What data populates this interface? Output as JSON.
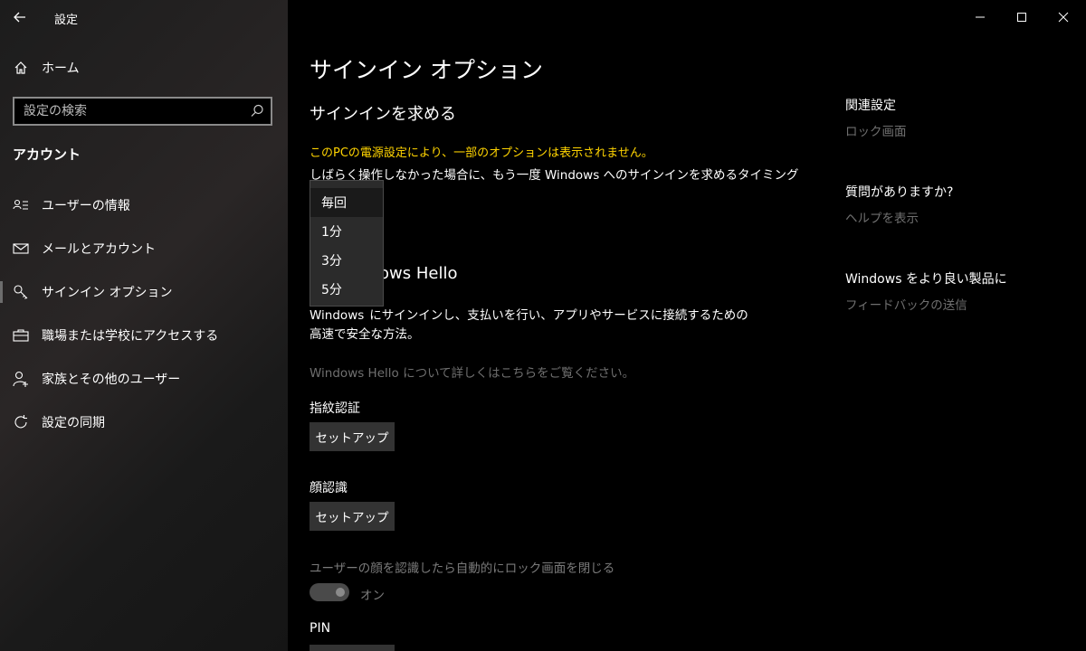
{
  "window": {
    "title": "設定",
    "controls": [
      "minimize",
      "maximize",
      "close"
    ]
  },
  "sidebar": {
    "home_label": "ホーム",
    "search_placeholder": "設定の検索",
    "section_label": "アカウント",
    "items": [
      {
        "label": "ユーザーの情報",
        "icon": "user-info-icon"
      },
      {
        "label": "メールとアカウント",
        "icon": "mail-icon"
      },
      {
        "label": "サインイン オプション",
        "icon": "key-icon",
        "selected": true
      },
      {
        "label": "職場または学校にアクセスする",
        "icon": "briefcase-icon"
      },
      {
        "label": "家族とその他のユーザー",
        "icon": "user-add-icon"
      },
      {
        "label": "設定の同期",
        "icon": "sync-icon"
      }
    ]
  },
  "main": {
    "page_title": "サインイン オプション",
    "require_heading": "サインインを求める",
    "power_warning": "このPCの電源設定により、一部のオプションは表示されません。",
    "timing_description": "しばらく操作しなかった場合に、もう一度 Windows へのサインインを求めるタイミング",
    "hello_heading": "Windows Hello",
    "hello_heading_visible": "lows Hello",
    "hello_desc_line1": "Windows にサインインし、支払いを行い、アプリやサービスに接続するための",
    "hello_desc_line1_visible_left": "Windows",
    "hello_desc_line1_visible_right": "にサインインし、支払いを行い、アプリやサービスに接続するための",
    "hello_desc_line2": "高速で安全な方法。",
    "hello_link": "Windows Hello について詳しくはこちらをご覧ください。",
    "fingerprint_title": "指紋認証",
    "fingerprint_button": "セットアップ",
    "face_title": "顔認識",
    "face_button": "セットアップ",
    "face_auto_lock_desc": "ユーザーの顔を認識したら自動的にロック画面を閉じる",
    "face_auto_lock_toggle": "オン",
    "pin_title": "PIN"
  },
  "dropdown": {
    "options": [
      "毎回",
      "1分",
      "3分",
      "5分"
    ],
    "selected": "毎回"
  },
  "related": {
    "related_heading": "関連設定",
    "related_link": "ロック画面",
    "question_heading": "質問がありますか?",
    "question_link": "ヘルプを表示",
    "better_heading": "Windows をより良い製品に",
    "better_link": "フィードバックの送信"
  },
  "colors": {
    "warning_text": "#ffd400",
    "link_gray": "#6f6f6f",
    "button_bg": "#333333"
  }
}
